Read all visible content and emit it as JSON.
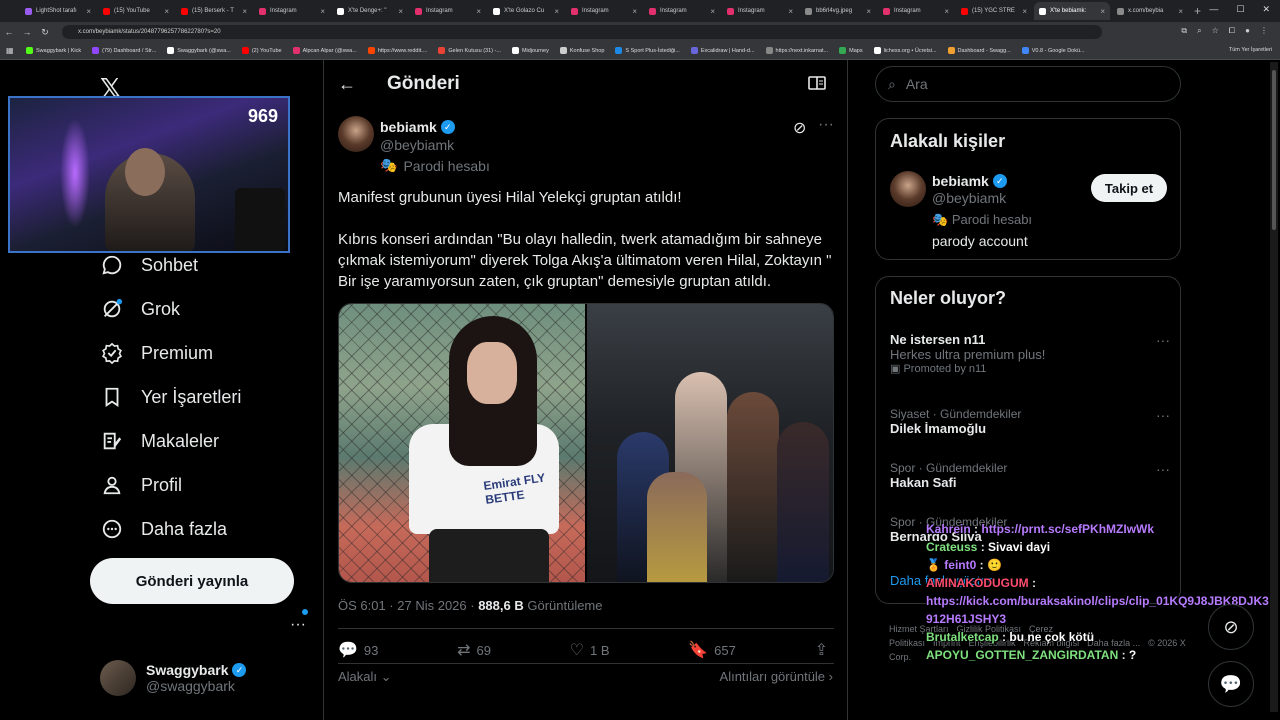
{
  "browser": {
    "tabs": [
      {
        "title": "LightShot tarafı",
        "color": "#9a5cf0"
      },
      {
        "title": "(15) YouTube",
        "color": "#ff0000"
      },
      {
        "title": "(15) Berserk - T",
        "color": "#ff0000"
      },
      {
        "title": "Instagram",
        "color": "#e1306c"
      },
      {
        "title": "X'te Denge+: \"",
        "color": "#ffffff"
      },
      {
        "title": "Instagram",
        "color": "#e1306c"
      },
      {
        "title": "X'te Golazo Cu",
        "color": "#ffffff"
      },
      {
        "title": "Instagram",
        "color": "#e1306c"
      },
      {
        "title": "Instagram",
        "color": "#e1306c"
      },
      {
        "title": "Instagram",
        "color": "#e1306c"
      },
      {
        "title": "bb6rl4vg.jpeg",
        "color": "#8a8a8a"
      },
      {
        "title": "Instagram",
        "color": "#e1306c"
      },
      {
        "title": "(15) YGC STRE",
        "color": "#ff0000"
      },
      {
        "title": "X'te bebiamk:",
        "color": "#ffffff",
        "active": true
      },
      {
        "title": "x.com/beybia",
        "color": "#8a8a8a"
      }
    ],
    "new_tab": "+",
    "url": "x.com/beybiamk/status/2048779625778622780?s=20",
    "bookmarks": [
      {
        "label": "Swaggybark | Kick",
        "color": "#53fc18"
      },
      {
        "label": "(79) Dashboard / Str...",
        "color": "#9146ff"
      },
      {
        "label": "Swaggybark (@swa...",
        "color": "#ffffff"
      },
      {
        "label": "(2) YouTube",
        "color": "#ff0000"
      },
      {
        "label": "Alpcan Alpar (@swa...",
        "color": "#e1306c"
      },
      {
        "label": "https://www.reddit....",
        "color": "#ff4500"
      },
      {
        "label": "Gelen Kutusu (31) -...",
        "color": "#ea4335"
      },
      {
        "label": "Midjourney",
        "color": "#ffffff"
      },
      {
        "label": "Konfuse Shop",
        "color": "#cccccc"
      },
      {
        "label": "S Sport Plus-İstediği...",
        "color": "#1e88e5"
      },
      {
        "label": "Excalidraw | Hand-d...",
        "color": "#6965db"
      },
      {
        "label": "https://next.inkarnat...",
        "color": "#888888"
      },
      {
        "label": "Maps",
        "color": "#34a853"
      },
      {
        "label": "lichess.org • Ücretsi...",
        "color": "#ffffff"
      },
      {
        "label": "Dashboard - Swagg...",
        "color": "#f0a030"
      },
      {
        "label": "V0.8 - Google Dokü...",
        "color": "#4285f4"
      }
    ],
    "all_bookmarks": "Tüm Yer İşaretleri"
  },
  "webcam": {
    "viewer_count": "969"
  },
  "left_nav": {
    "items": [
      {
        "label": "Sohbet",
        "icon": "chat-icon"
      },
      {
        "label": "Grok",
        "icon": "grok-icon"
      },
      {
        "label": "Premium",
        "icon": "premium-icon"
      },
      {
        "label": "Yer İşaretleri",
        "icon": "bookmark-icon"
      },
      {
        "label": "Makaleler",
        "icon": "article-icon"
      },
      {
        "label": "Profil",
        "icon": "profile-icon"
      },
      {
        "label": "Daha fazla",
        "icon": "more-icon"
      }
    ],
    "post_button": "Gönderi yayınla",
    "account": {
      "name": "Swaggybark",
      "handle": "@swaggybark"
    }
  },
  "post": {
    "header_title": "Gönderi",
    "author": {
      "name": "bebiamk",
      "handle": "@beybiamk",
      "label": "Parodi hesabı"
    },
    "text_1": "Manifest grubunun üyesi Hilal Yelekçi gruptan atıldı!",
    "text_2": "Kıbrıs konseri ardından \"Bu olayı halledin, twerk atamadığım bir sahneye çıkmak istemiyorum\" diyerek Tolga Akış'a ültimatom veren Hilal, Zoktayın \" Bir işe yaramıyorsun zaten, çık gruptan\" demesiyle gruptan atıldı.",
    "shirt_text": "Emirat FLY BETTE",
    "time": "ÖS 6:01 · 27 Nis 2026 · ",
    "views": "888,6 B",
    "views_label": " Görüntüleme",
    "replies": "93",
    "reposts": "69",
    "likes": "1 B",
    "bookmarks": "657",
    "related": "Alakalı",
    "quotes": "Alıntıları görüntüle"
  },
  "right": {
    "search_placeholder": "Ara",
    "related_title": "Alakalı kişiler",
    "related_person": {
      "name": "bebiamk",
      "handle": "@beybiamk",
      "label": "Parodi hesabı",
      "bio": "parody account",
      "follow": "Takip et"
    },
    "trends_title": "Neler oluyor?",
    "trends": [
      {
        "category": "",
        "name": "Ne istersen n11",
        "sub": "Herkes ultra premium plus!",
        "promo": "Promoted by n11"
      },
      {
        "category": "Siyaset · Gündemdekiler",
        "name": "Dilek İmamoğlu"
      },
      {
        "category": "Spor · Gündemdekiler",
        "name": "Hakan Safi"
      },
      {
        "category": "Spor · Gündemdekiler",
        "name": "Bernardo Silva"
      }
    ],
    "show_more": "Daha fazla göster",
    "footer": [
      "Hizmet Şartları",
      "Gizlilik Politikası",
      "Çerez Politikası",
      "Imprint",
      "Erişilebilirlik",
      "Reklam bilgisi",
      "Daha fazla ...",
      "© 2026 X Corp."
    ]
  },
  "chat": [
    {
      "user": "Kahrein",
      "msg": "https://prnt.sc/sefPKhMZIwWk"
    },
    {
      "user": "Crateuss",
      "msg": "Sivavi dayi"
    },
    {
      "user": "feint0",
      "msg": ""
    },
    {
      "user": "AMINAKODUGUM",
      "msg": ""
    },
    {
      "user": "",
      "msg": "https://kick.com/buraksakinol/clips/clip_01KQ9J8JBK8DJK3912H61JSHY3"
    },
    {
      "user": "Brutalketcap",
      "msg": "bu ne çok kötü"
    },
    {
      "user": "APOYU_GOTTEN_ZANGIRDATAN",
      "msg": "?"
    }
  ]
}
